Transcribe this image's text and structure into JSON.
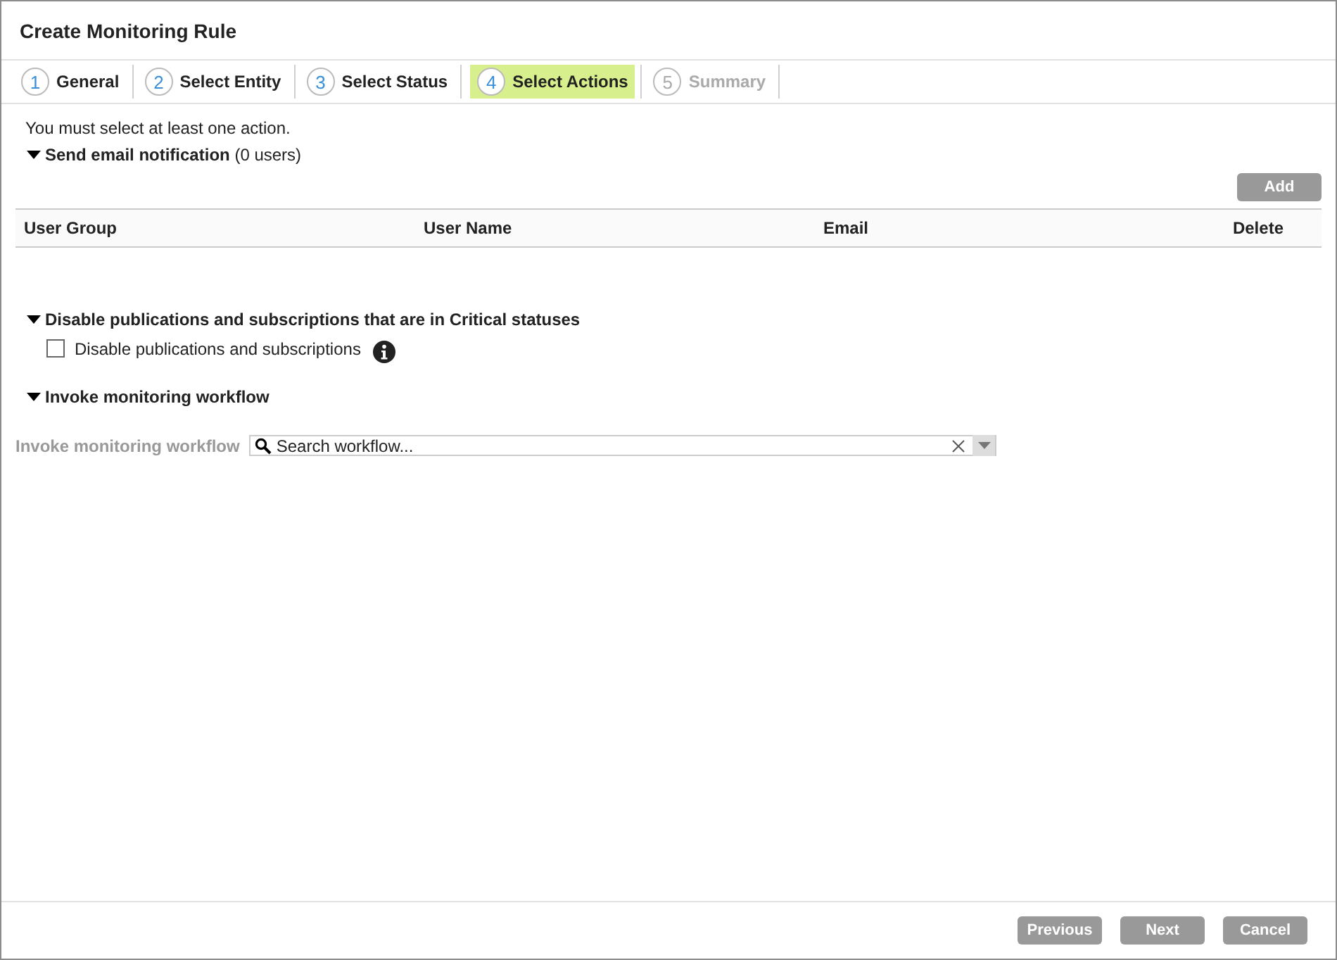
{
  "window": {
    "title": "Create Monitoring Rule"
  },
  "steps": [
    {
      "number": "1",
      "label": "General",
      "selected": false,
      "disabled": false
    },
    {
      "number": "2",
      "label": "Select Entity",
      "selected": false,
      "disabled": false
    },
    {
      "number": "3",
      "label": "Select Status",
      "selected": false,
      "disabled": false
    },
    {
      "number": "4",
      "label": "Select Actions",
      "selected": true,
      "disabled": false
    },
    {
      "number": "5",
      "label": "Summary",
      "selected": false,
      "disabled": true
    }
  ],
  "message": "You must select at least one action.",
  "email_section": {
    "title": "Send email notification",
    "count": "(0 users)",
    "expanded": true,
    "add_button": "Add",
    "columns": [
      "User Group",
      "User Name",
      "Email",
      "Delete"
    ]
  },
  "disable_section": {
    "title": "Disable publications and subscriptions that are in Critical statuses",
    "expanded": true,
    "checkbox": {
      "label": "Disable publications and subscriptions",
      "checked": false
    }
  },
  "workflow_section": {
    "title": "Invoke monitoring workflow",
    "expanded": true,
    "field_label": "Invoke monitoring workflow",
    "placeholder": "Search workflow..."
  },
  "buttons": [
    "Previous",
    "Next",
    "Cancel"
  ]
}
